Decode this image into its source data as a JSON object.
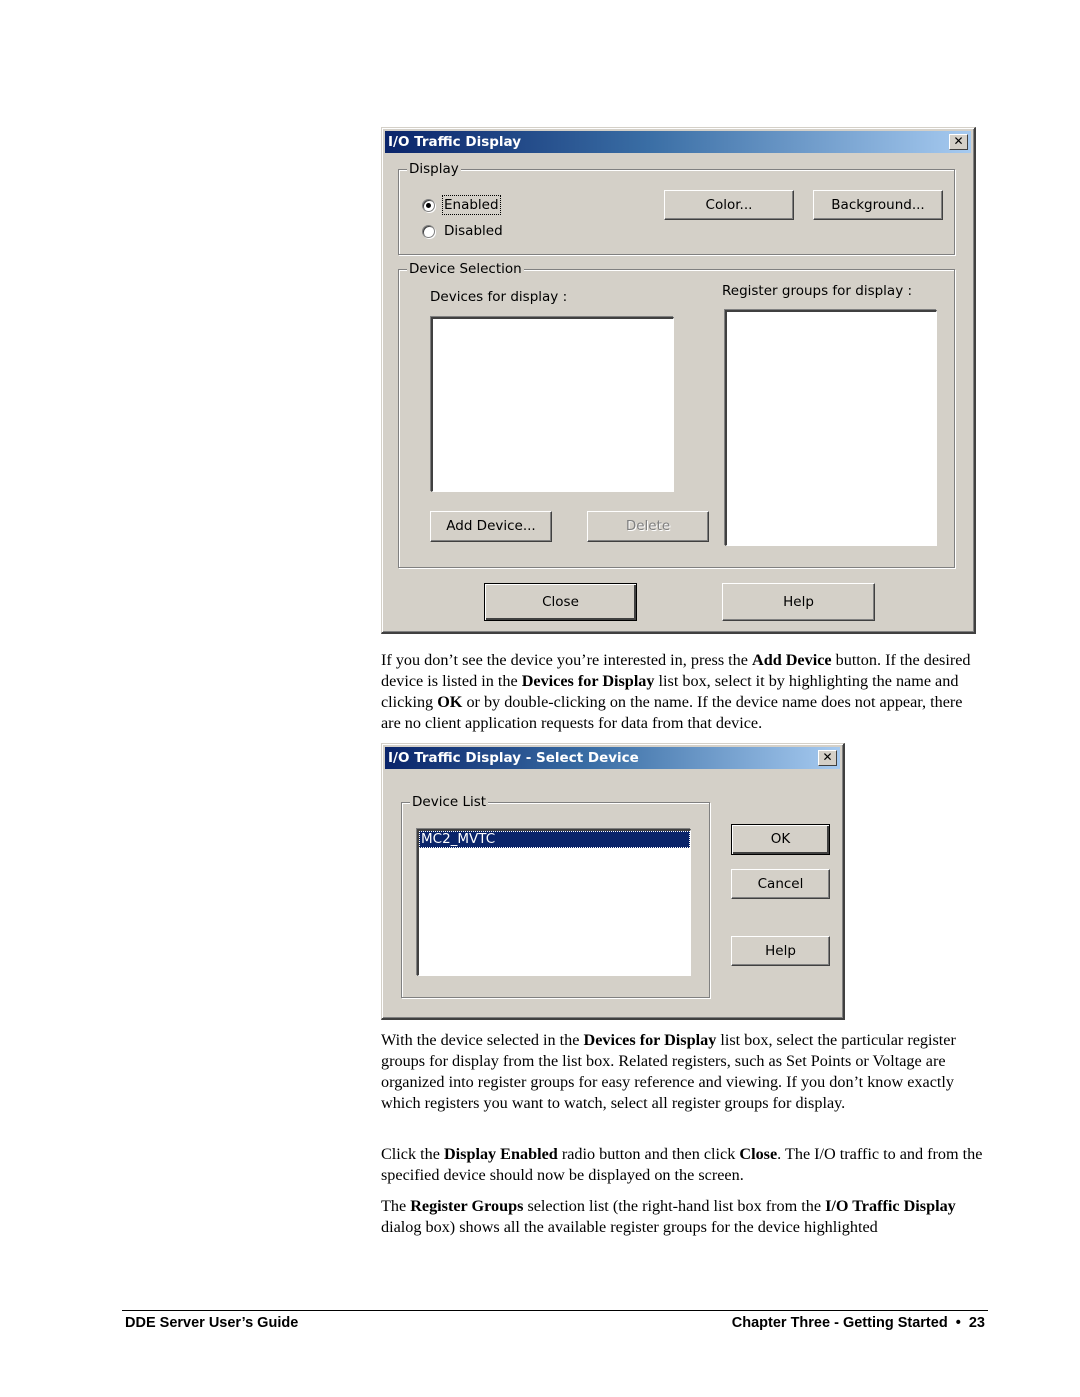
{
  "dialog_main": {
    "title": "I/O Traffic Display",
    "close_glyph": "✕",
    "display_group": {
      "label": "Display",
      "radio_enabled": "Enabled",
      "radio_disabled": "Disabled",
      "selected": "Enabled",
      "color_button": "Color...",
      "background_button": "Background..."
    },
    "device_selection_group": {
      "label": "Device Selection",
      "devices_label": "Devices for display :",
      "devices_items": [],
      "register_groups_label": "Register groups for display :",
      "register_groups_items": [],
      "add_device_button": "Add Device...",
      "delete_button": "Delete"
    },
    "close_button": "Close",
    "help_button": "Help"
  },
  "dialog_select": {
    "title": "I/O Traffic Display - Select Device",
    "close_glyph": "✕",
    "device_list_label": "Device List",
    "device_list_items": [
      "MC2_MVTC"
    ],
    "selected_item": "MC2_MVTC",
    "ok_button": "OK",
    "cancel_button": "Cancel",
    "help_button": "Help"
  },
  "paragraphs": {
    "p1": [
      {
        "t": "If you don’t see the device you’re interested in, press the ",
        "b": false
      },
      {
        "t": "Add Device",
        "b": true
      },
      {
        "t": " button. If the desired device is listed in the ",
        "b": false
      },
      {
        "t": "Devices for Display",
        "b": true
      },
      {
        "t": " list box, select it by highlighting the name and clicking ",
        "b": false
      },
      {
        "t": "OK",
        "b": true
      },
      {
        "t": " or by double-clicking on the name. If the device name does not appear, there are no client application requests for data from that device.",
        "b": false
      }
    ],
    "p2": [
      {
        "t": "With the device selected in the ",
        "b": false
      },
      {
        "t": "Devices for Display",
        "b": true
      },
      {
        "t": " list box, select the particular register groups for display from the list box. Related registers, such as Set Points or Voltage are organized into register groups for easy reference and viewing. If you don’t know exactly which registers you want to watch, select all register groups for display.",
        "b": false
      }
    ],
    "p3": [
      {
        "t": "Click the ",
        "b": false
      },
      {
        "t": "Display Enabled",
        "b": true
      },
      {
        "t": " radio button and then click ",
        "b": false
      },
      {
        "t": "Close",
        "b": true
      },
      {
        "t": ". The I/O traffic to and from the specified device should now be displayed on the screen.",
        "b": false
      }
    ],
    "p4": [
      {
        "t": "The ",
        "b": false
      },
      {
        "t": "Register Groups",
        "b": true
      },
      {
        "t": " selection list (the right-hand list box from the ",
        "b": false
      },
      {
        "t": "I/O Traffic Display",
        "b": true
      },
      {
        "t": " dialog box) shows all the available register groups for the device highlighted",
        "b": false
      }
    ]
  },
  "footer": {
    "left": "DDE Server User’s Guide",
    "right": "Chapter Three - Getting Started  •  23"
  }
}
